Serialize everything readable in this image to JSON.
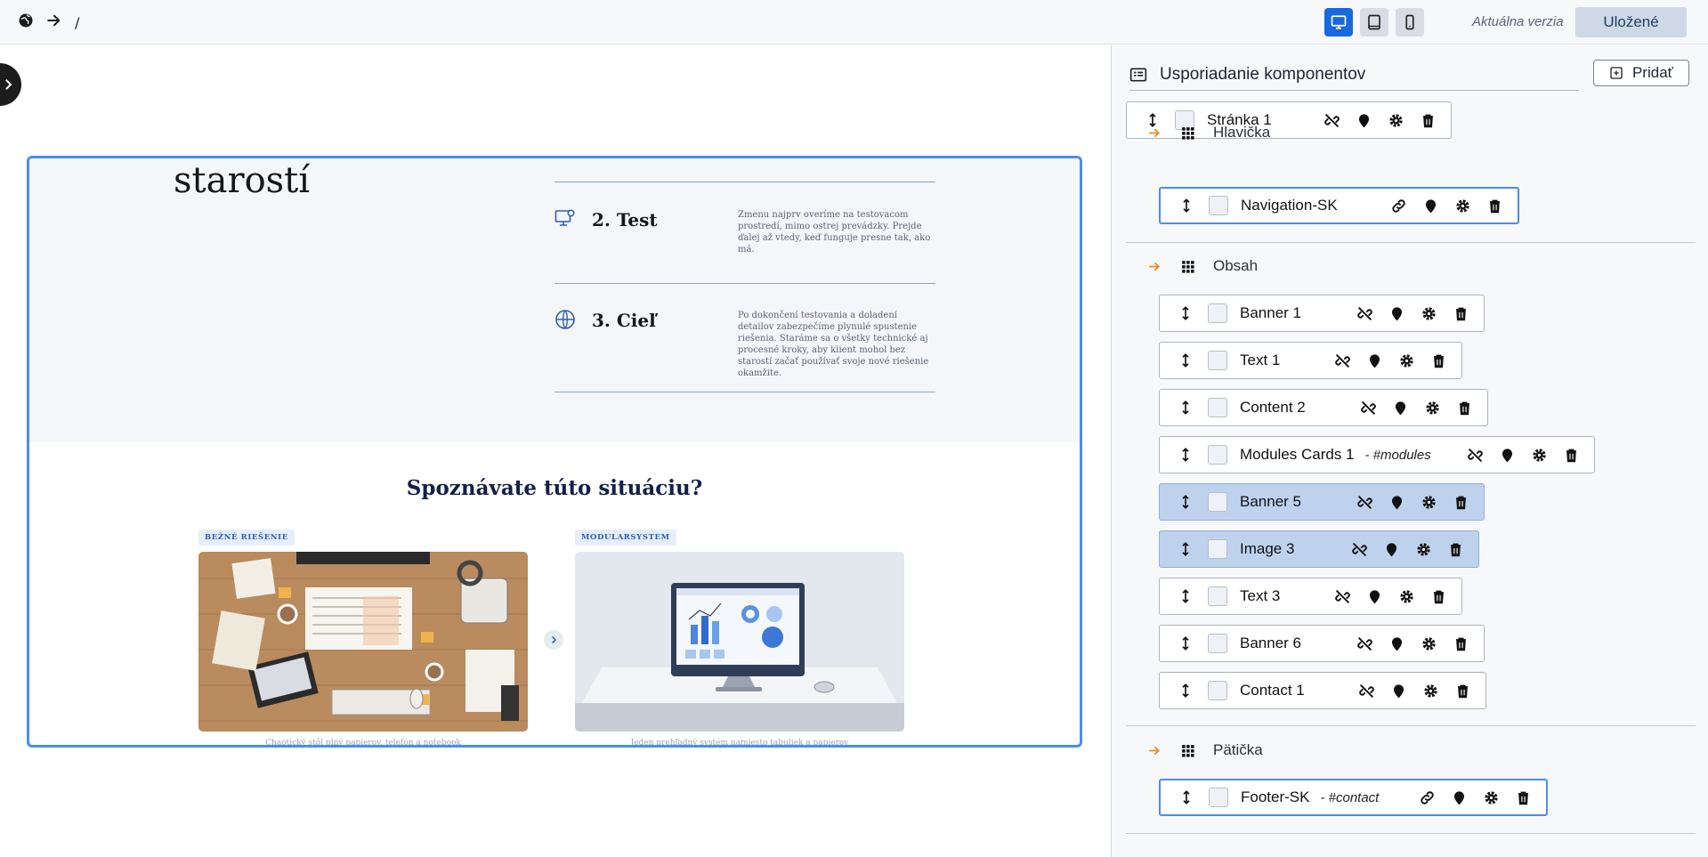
{
  "topbar": {
    "path": "/",
    "version_label": "Aktuálna verzia",
    "saved_label": "Uložené"
  },
  "canvas": {
    "big_word": "starostí",
    "steps": [
      {
        "title": "2. Test",
        "text": "Zmenu najprv overíme na testovacom prostredí, mimo ostrej prevádzky. Prejde ďalej až vtedy, keď funguje presne tak, ako má.",
        "icon": "monitor-gear-icon"
      },
      {
        "title": "3. Cieľ",
        "text": "Po dokončení testovania a doladení detailov zabezpečíme plynulé spustenie riešenia. Staráme sa o všetky technické aj procesné kroky, aby klient mohol bez starostí začať používať svoje nové riešenie okamžite.",
        "icon": "globe-icon"
      }
    ],
    "situation_title": "Spoznávate túto situáciu?",
    "tag_left": "BEŽNÉ RIEŠENIE",
    "tag_right": "MODULARSYSTEM",
    "caption_left": "Chaotický stôl plný papierov, telefón a notebook",
    "caption_right": "Jeden prehľadný systém namiesto tabuliek a papierov"
  },
  "panel": {
    "title": "Usporiadanie komponentov",
    "add_label": "Pridať",
    "page": {
      "label": "Stránka 1"
    },
    "groups": {
      "header": "Hlavička",
      "content": "Obsah",
      "footer": "Pätička"
    },
    "header_items": [
      {
        "label": "Navigation-SK",
        "anchor": ""
      }
    ],
    "content_items": [
      {
        "label": "Banner 1",
        "anchor": ""
      },
      {
        "label": "Text 1",
        "anchor": ""
      },
      {
        "label": "Content 2",
        "anchor": ""
      },
      {
        "label": "Modules Cards 1",
        "anchor": "- #modules"
      },
      {
        "label": "Banner 5",
        "anchor": ""
      },
      {
        "label": "Image 3",
        "anchor": ""
      },
      {
        "label": "Text 3",
        "anchor": ""
      },
      {
        "label": "Banner 6",
        "anchor": ""
      },
      {
        "label": "Contact 1",
        "anchor": ""
      }
    ],
    "footer_items": [
      {
        "label": "Footer-SK",
        "anchor": "- #contact"
      }
    ]
  },
  "colors": {
    "accent": "#1769e0",
    "selection": "#4a8df0",
    "group_arrow": "#f08c28",
    "highlight": "#bed2ee"
  }
}
